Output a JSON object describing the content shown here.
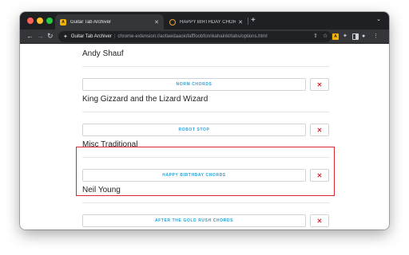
{
  "tabs": [
    {
      "title": "Guitar Tab Archiver",
      "favicon": "A",
      "active": true
    },
    {
      "title": "HAPPY BIRTHDAY CHORDS by Misc Traditional",
      "active": false
    }
  ],
  "toolbar": {
    "omnibox_name": "Guitar Tab Archiver",
    "omnibox_url": "chrome-extension://aofaeidaaoiofafffoobfcnnkahainkl/tabs/options.html",
    "ext_badge": "A"
  },
  "groups": [
    {
      "artist": "Andy Shauf",
      "song": "NORM CHORDS",
      "delete_label": "✕"
    },
    {
      "artist": "King Gizzard and the Lizard Wizard",
      "song": "ROBOT STOP",
      "delete_label": "✕"
    },
    {
      "artist": "Misc Traditional",
      "song": "HAPPY BIRTHDAY CHORDS",
      "delete_label": "✕"
    },
    {
      "artist": "Neil Young",
      "song": "AFTER THE GOLD RUSH CHORDS",
      "delete_label": "✕"
    }
  ],
  "colors": {
    "accent_link": "#2a9fd6",
    "delete_red": "#e0262f",
    "highlight": "#e0262f"
  }
}
